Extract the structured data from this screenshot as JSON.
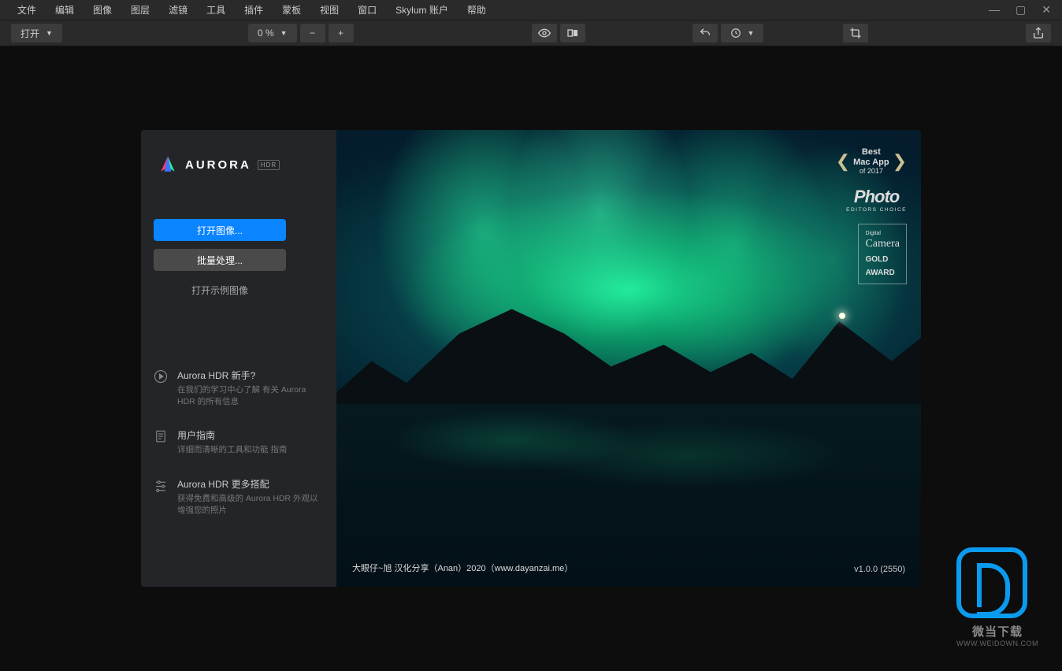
{
  "menu": {
    "items": [
      "文件",
      "编辑",
      "图像",
      "图层",
      "滤镜",
      "工具",
      "插件",
      "蒙板",
      "视图",
      "窗口",
      "Skylum 账户",
      "帮助"
    ]
  },
  "toolbar": {
    "open_label": "打开",
    "zoom_label": "0 %"
  },
  "app": {
    "name": "AURORA",
    "badge": "HDR"
  },
  "actions": {
    "open_image": "打开图像...",
    "batch": "批量处理...",
    "example": "打开示例图像"
  },
  "help": [
    {
      "title": "Aurora HDR 新手?",
      "desc": "在我们的学习中心了解\n有关 Aurora HDR 的所有信息"
    },
    {
      "title": "用户指南",
      "desc": "详细而清晰的工具和功能\n指南"
    },
    {
      "title": "Aurora HDR 更多搭配",
      "desc": "获得免费和高级的 Aurora HDR\n外观以增强您的照片"
    }
  ],
  "awards": {
    "best_line1": "Best",
    "best_line2": "Mac App",
    "best_line3": "of 2017",
    "photo_brand": "Photo",
    "photo_sub": "EDITORS CHOICE",
    "camera_brand": "Camera",
    "camera_pre": "Digital",
    "gold1": "GOLD",
    "gold2": "AWARD"
  },
  "credit": "大眼仔~旭 汉化分享（Anan）2020（www.dayanzai.me）",
  "version": "v1.0.0 (2550)",
  "watermark": {
    "text": "微当下载",
    "url": "WWW.WEIDOWN.COM"
  }
}
